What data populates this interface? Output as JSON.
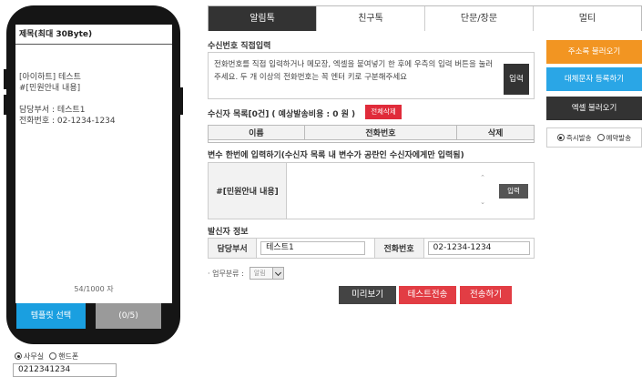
{
  "phone": {
    "subject_placeholder": "제목(최대 30Byte)",
    "message": "[아이하트] 테스트\n#[민원안내 내용]\n\n담당부서 : 테스트1\n전화번호 : 02-1234-1234",
    "byte_count": "54/1000 자",
    "template_button": "템플릿 선택",
    "count_button": "(0/5)",
    "mode_options": [
      {
        "label": "사무실",
        "selected": true
      },
      {
        "label": "핸드폰",
        "selected": false
      }
    ],
    "sender_number": "0212341234"
  },
  "tabs": [
    "알림톡",
    "친구톡",
    "단문/장문",
    "멀티"
  ],
  "direct_input": {
    "title": "수신번호 직접입력",
    "instructions": "전화번호를 직접 입력하거나 메모장, 엑셀을 붙여넣기 한 후에 우측의 입력 버튼을 눌러주세요. 두 개 이상의 전화번호는 꼭 엔터 키로 구분해주세요",
    "input_button": "입력"
  },
  "recipients": {
    "title": "수신자 목록[0건] ( 예상발송비용 : 0 원 )",
    "delete_all_button": "전체삭제",
    "columns": [
      "이름",
      "전화번호",
      "삭제"
    ]
  },
  "variables": {
    "title": "변수 한번에 입력하기(수신자 목록 내 변수가 공란인 수신자에게만 입력됨)",
    "var_label": "#[민원안내 내용]",
    "input_button": "입력"
  },
  "sender": {
    "title": "발신자 정보",
    "dept_label": "담당부서",
    "dept_value": "테스트1",
    "phone_label": "전화번호",
    "phone_value": "02-1234-1234"
  },
  "category": {
    "label": "· 업무분류 :",
    "selected": "알림"
  },
  "actions": {
    "preview": "미리보기",
    "test_send": "테스트전송",
    "send": "전송하기"
  },
  "side": {
    "address_book": "주소록 불러오기",
    "alt_text": "대체문자 등록하기",
    "excel": "엑셀 불러오기",
    "send_modes": [
      {
        "label": "즉시발송",
        "selected": true
      },
      {
        "label": "예약발송",
        "selected": false
      }
    ]
  },
  "colors": {
    "active_tab": "#333333",
    "orange": "#f29522",
    "blue": "#2aa6e6",
    "red": "#e23d44"
  }
}
